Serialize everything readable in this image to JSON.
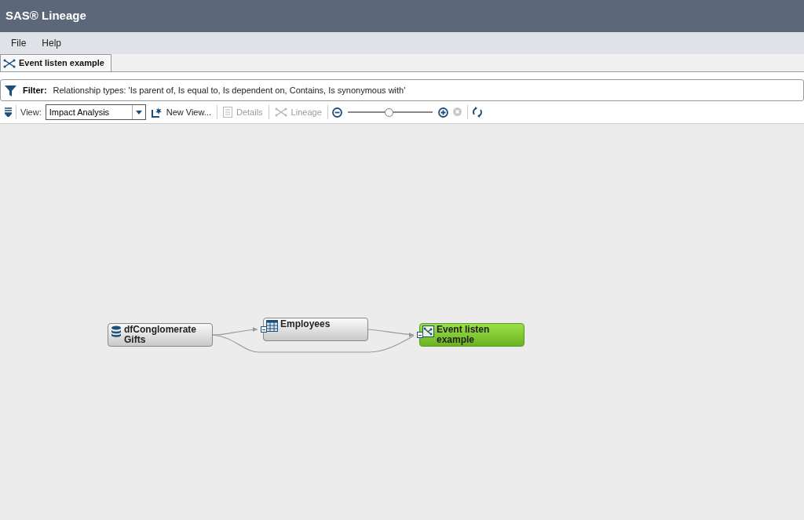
{
  "app_title": "SAS® Lineage",
  "menu": [
    "File",
    "Help"
  ],
  "tabs": [
    {
      "label": "Event listen example",
      "selected": true
    }
  ],
  "filter": {
    "label": "Filter:",
    "text": "Relationship types: 'Is parent of, Is equal to, Is dependent on, Contains, Is synonymous with'"
  },
  "toolbar": {
    "view_label": "View:",
    "view_value": "Impact Analysis",
    "buttons": [
      {
        "kind": "new",
        "label": "New View...",
        "disabled": false
      },
      {
        "kind": "details",
        "label": "Details",
        "disabled": true
      },
      {
        "kind": "lineage",
        "label": "Lineage",
        "disabled": true
      }
    ],
    "zoom": {
      "level": 0.48
    },
    "reset_disabled": true
  },
  "nodes": [
    {
      "kind": "database",
      "label": "dfConglomerate Gifts",
      "selected": false
    },
    {
      "kind": "table",
      "label": "Employees",
      "selected": false
    },
    {
      "kind": "job",
      "label": "Event listen example",
      "selected": true
    }
  ]
}
